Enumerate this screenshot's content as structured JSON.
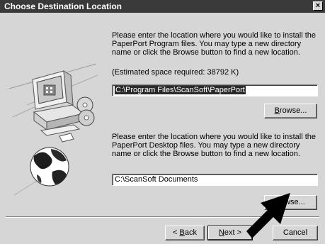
{
  "window": {
    "title": "Choose Destination Location"
  },
  "program_section": {
    "instructions": "Please enter the location where you would like to install the PaperPort Program files.  You may type a new directory name or click the Browse button to find a new location.",
    "space_required": "(Estimated space required:  38792 K)",
    "path_value": "C:\\Program Files\\ScanSoft\\PaperPort",
    "browse_label_prefix": "B",
    "browse_label_rest": "rowse..."
  },
  "desktop_section": {
    "instructions": "Please enter the location where you would like to install the PaperPort Desktop files.  You may type a new directory name or click the Browse button to find a new location.",
    "path_value": "C:\\ScanSoft Documents",
    "browse_label_visible": "owse..."
  },
  "footer": {
    "back_prefix": "< ",
    "back_key": "B",
    "back_rest": "ack",
    "next_key": "N",
    "next_rest": "ext >",
    "cancel_label": "Cancel"
  },
  "icons": [
    "close-icon",
    "computer-icon",
    "cd-icon",
    "globe-icon",
    "arrow-pointer-icon"
  ]
}
